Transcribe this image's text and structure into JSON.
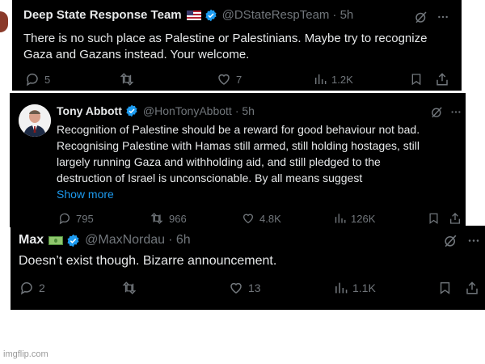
{
  "tweets": [
    {
      "name": "Deep State Response Team",
      "handle": "@DStateRespTeam",
      "time": "· 5h",
      "text_line1": "There is no such place as Palestine or Palestinians. Maybe try to recognize",
      "text_line2": "Gaza and Gazans instead. Your welcome.",
      "replies": "5",
      "retweets": "",
      "likes": "7",
      "views": "1.2K"
    },
    {
      "name": "Tony Abbott",
      "handle": "@HonTonyAbbott",
      "time": "· 5h",
      "text_line1": "Recognition of Palestine should be a reward for good behaviour not bad.",
      "text_line2": "Recognising Palestine with Hamas still armed, still holding hostages, still",
      "text_line3": "largely running Gaza and withholding aid, and still pledged to the",
      "text_line4": "destruction of Israel is unconscionable. By all means suggest",
      "show_more": "Show more",
      "replies": "795",
      "retweets": "966",
      "likes": "4.8K",
      "views": "126K"
    },
    {
      "name": "Max",
      "handle": "@MaxNordau",
      "time": "· 6h",
      "text_line1": "Doesn’t exist though. Bizarre announcement.",
      "replies": "2",
      "retweets": "",
      "likes": "13",
      "views": "1.1K"
    }
  ],
  "watermark": "imgflip.com",
  "colors": {
    "background": "#000000",
    "text": "#e7e9ea",
    "muted": "#71767b",
    "link": "#1d9bf0",
    "verified": "#1d9bf0"
  }
}
